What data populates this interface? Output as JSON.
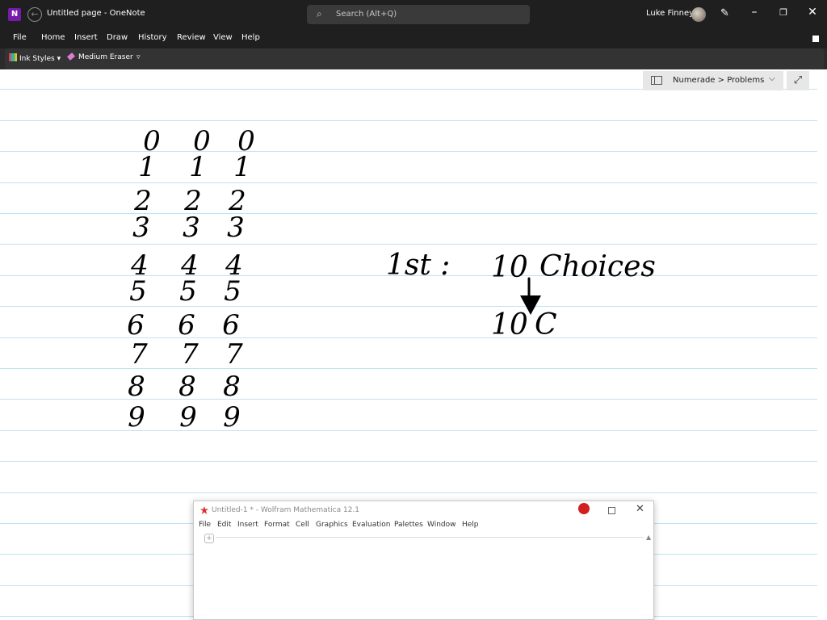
{
  "titlebar": {
    "app_icon": "N",
    "doc_title": "Untitled page  -  OneNote",
    "search_placeholder": "Search (Alt+Q)",
    "user_name": "Luke Finney",
    "icons": [
      "back-arrow-icon",
      "search-icon",
      "pen-icon",
      "minimize-icon",
      "restore-icon",
      "close-icon"
    ]
  },
  "menubar": {
    "items": [
      "File",
      "Home",
      "Insert",
      "Draw",
      "History",
      "Review",
      "View",
      "Help"
    ]
  },
  "toolbar": {
    "ink_styles": "Ink Styles",
    "eraser": "Medium Eraser",
    "overflow": "▿"
  },
  "navigation": {
    "breadcrumb": "Numerade > Problems",
    "chevron": "⌵",
    "expand": "⤢"
  },
  "ink": {
    "columns": [
      [
        "0",
        "1",
        "2",
        "3",
        "4",
        "5",
        "6",
        "7",
        "8",
        "9"
      ],
      [
        "0",
        "1",
        "2",
        "3",
        "4",
        "5",
        "6",
        "7",
        "8",
        "9"
      ],
      [
        "0",
        "1",
        "2",
        "3",
        "4",
        "5",
        "6",
        "7",
        "8",
        "9"
      ]
    ],
    "note_line1_a": "1st :",
    "note_line1_b": "10",
    "note_line1_c": "Choices",
    "note_line2_a": "10",
    "note_line2_b": "C"
  },
  "mathematica": {
    "title": "Untitled-1 * - Wolfram Mathematica 12.1",
    "menu": [
      "File",
      "Edit",
      "Insert",
      "Format",
      "Cell",
      "Graphics",
      "Evaluation",
      "Palettes",
      "Window",
      "Help"
    ],
    "cell_bracket": "+",
    "close": "✕"
  },
  "colors": {
    "titlebar_bg": "#1f1f1f",
    "rule_line": "#bfe2f3",
    "ink": "#000000",
    "onenote_purple": "#7719aa"
  }
}
